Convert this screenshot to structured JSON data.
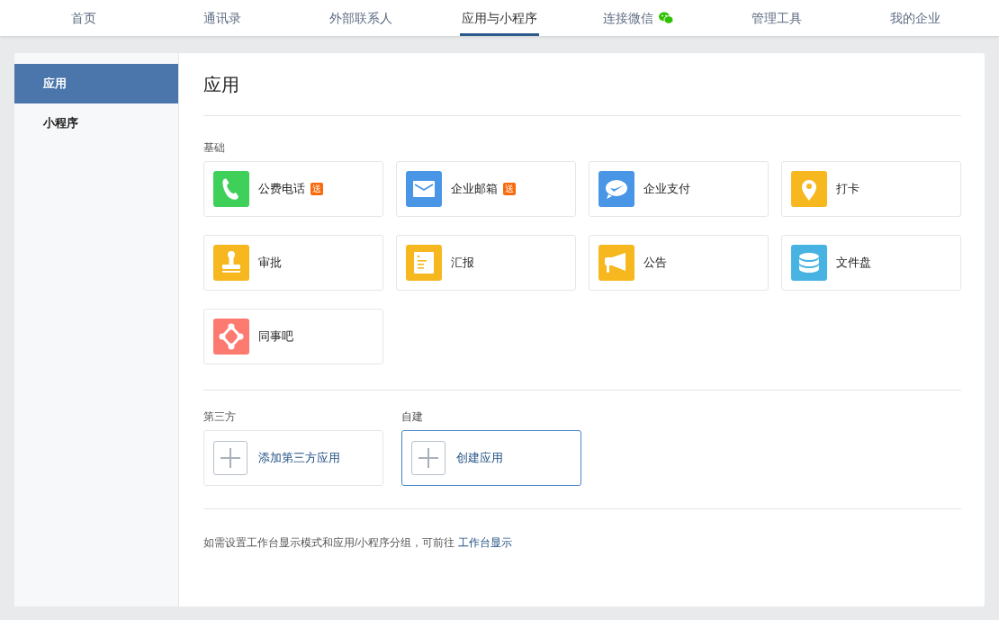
{
  "nav": [
    {
      "label": "首页",
      "selected": false
    },
    {
      "label": "通讯录",
      "selected": false
    },
    {
      "label": "外部联系人",
      "selected": false
    },
    {
      "label": "应用与小程序",
      "selected": true
    },
    {
      "label": "连接微信",
      "selected": false,
      "wechat_icon": true
    },
    {
      "label": "管理工具",
      "selected": false
    },
    {
      "label": "我的企业",
      "selected": false
    }
  ],
  "sidebar": {
    "items": [
      {
        "label": "应用",
        "selected": true
      },
      {
        "label": "小程序",
        "selected": false
      }
    ]
  },
  "title": "应用",
  "basic": {
    "heading": "基础",
    "apps": [
      {
        "name": "公费电话",
        "kind": "phone",
        "color": "#3fd05a",
        "badge": "送"
      },
      {
        "name": "企业邮箱",
        "kind": "mail",
        "color": "#4a96e6",
        "badge": "送"
      },
      {
        "name": "企业支付",
        "kind": "pay",
        "color": "#4a96e6"
      },
      {
        "name": "打卡",
        "kind": "pin",
        "color": "#f6b81e"
      },
      {
        "name": "审批",
        "kind": "stamp",
        "color": "#f6b81e"
      },
      {
        "name": "汇报",
        "kind": "report",
        "color": "#f6b81e"
      },
      {
        "name": "公告",
        "kind": "megaphone",
        "color": "#f6b81e"
      },
      {
        "name": "文件盘",
        "kind": "disk",
        "color": "#47b3e2"
      },
      {
        "name": "同事吧",
        "kind": "network",
        "color": "#fc7a70"
      }
    ]
  },
  "add_groups": [
    {
      "heading": "第三方",
      "action": "添加第三方应用",
      "highlighted": false
    },
    {
      "heading": "自建",
      "action": "创建应用",
      "highlighted": true
    }
  ],
  "footer": {
    "text": "如需设置工作台显示模式和应用/小程序分组，可前往",
    "link": "工作台显示"
  }
}
